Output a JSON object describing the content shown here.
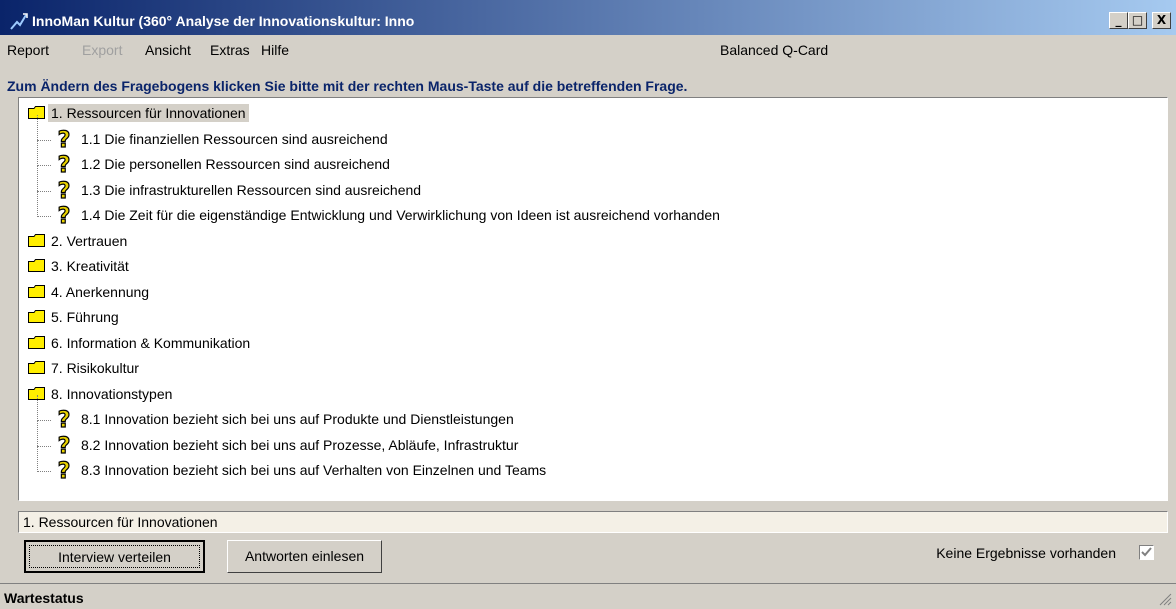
{
  "window": {
    "title": "InnoMan Kultur (360° Analyse der Innovationskultur: Inno",
    "minimize": "_",
    "maximize": "□",
    "close": "X"
  },
  "menu": {
    "items": [
      "Report",
      "Export",
      "Ansicht",
      "Extras",
      "Hilfe"
    ],
    "disabled": [
      "Export"
    ],
    "right_label": "Balanced Q-Card"
  },
  "instruction": "Zum Ändern des Fragebogens klicken Sie bitte mit der rechten Maus-Taste auf die betreffenden Frage.",
  "tree": {
    "nodes": [
      {
        "type": "folder",
        "label": "1. Ressourcen für Innovationen",
        "selected": true
      },
      {
        "type": "question",
        "label": "1.1 Die finanziellen Ressourcen sind ausreichend"
      },
      {
        "type": "question",
        "label": "1.2 Die personellen Ressourcen sind ausreichend"
      },
      {
        "type": "question",
        "label": "1.3 Die infrastrukturellen Ressourcen sind ausreichend"
      },
      {
        "type": "question",
        "label": "1.4 Die Zeit für die eigenständige Entwicklung und Verwirklichung von Ideen ist ausreichend vorhanden"
      },
      {
        "type": "folder",
        "label": "2. Vertrauen"
      },
      {
        "type": "folder",
        "label": "3. Kreativität"
      },
      {
        "type": "folder",
        "label": "4. Anerkennung"
      },
      {
        "type": "folder",
        "label": "5. Führung"
      },
      {
        "type": "folder",
        "label": "6. Information & Kommunikation"
      },
      {
        "type": "folder",
        "label": "7. Risikokultur"
      },
      {
        "type": "folder",
        "label": "8. Innovationstypen"
      },
      {
        "type": "question",
        "label": "8.1 Innovation bezieht sich bei uns auf Produkte und Dienstleistungen"
      },
      {
        "type": "question",
        "label": "8.2 Innovation bezieht sich bei uns auf Prozesse, Abläufe, Infrastruktur"
      },
      {
        "type": "question",
        "label": "8.3 Innovation bezieht sich bei uns auf Verhalten von Einzelnen und Teams"
      }
    ]
  },
  "selected_path": "1. Ressourcen für Innovationen",
  "buttons": {
    "distribute": "Interview verteilen",
    "import": "Antworten einlesen"
  },
  "results_label": "Keine Ergebnisse vorhanden",
  "results_checked": true,
  "status": "Wartestatus",
  "icons": {
    "app": "graph-pen-icon",
    "folder": "folder-icon",
    "question": "question-mark-icon"
  },
  "colors": {
    "title_start": "#0a246a",
    "title_end": "#a6caf0",
    "instruction": "#0a246a",
    "folder": "#ffee00",
    "question": "#e8d200"
  }
}
